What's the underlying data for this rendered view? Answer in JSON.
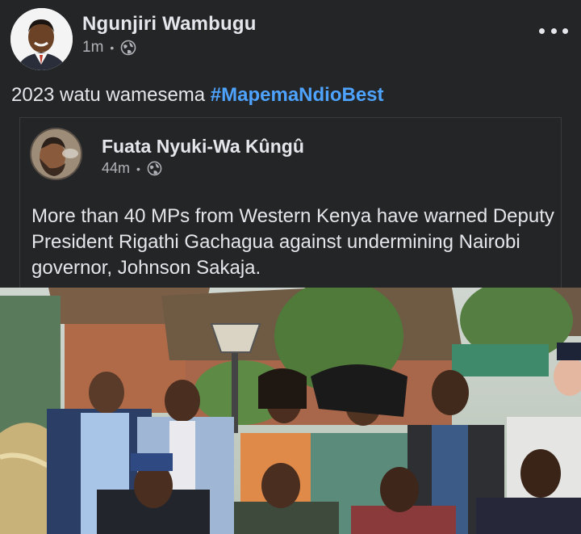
{
  "post": {
    "author": "Ngunjiri Wambugu",
    "time": "1m",
    "privacy_icon": "globe-icon",
    "more_icon": "more-horizontal-icon",
    "text_prefix": "2023 watu wamesema ",
    "hashtag": "#MapemaNdioBest"
  },
  "shared_post": {
    "author": "Fuata Nyuki-Wa Kûngû",
    "time": "44m",
    "privacy_icon": "globe-icon",
    "text": "More than 40 MPs from Western Kenya have warned Deputy President Rigathi Gachagua against undermining Nairobi governor, Johnson Sakaja."
  },
  "colors": {
    "background": "#242526",
    "text": "#e4e6eb",
    "secondary_text": "#b0b3b8",
    "hashtag": "#4ea3ff",
    "card_border": "#3a3b3c"
  }
}
